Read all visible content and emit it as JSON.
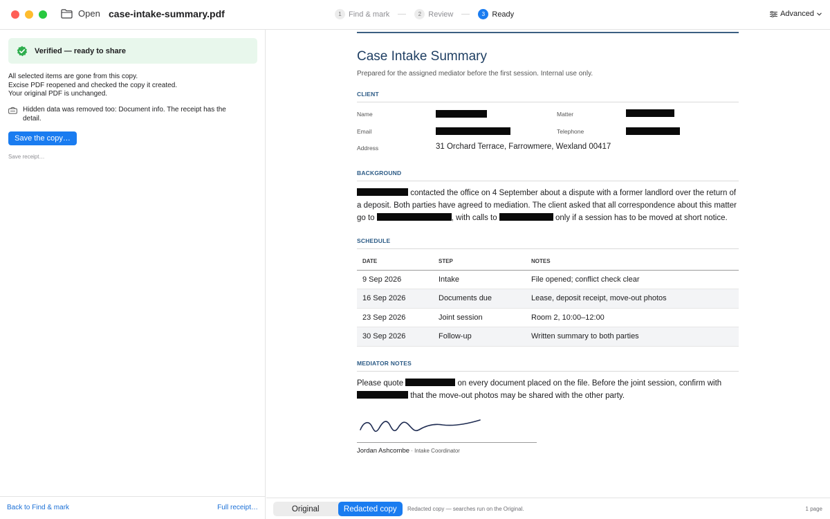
{
  "window": {
    "open_label": "Open",
    "filename": "case-intake-summary.pdf",
    "advanced_label": "Advanced",
    "steps": [
      {
        "num": "1",
        "label": "Find & mark"
      },
      {
        "num": "2",
        "label": "Review"
      },
      {
        "num": "3",
        "label": "Ready"
      }
    ],
    "active_step": 3
  },
  "sidebar": {
    "verified_title": "Verified — ready to share",
    "status_lines": [
      "All selected items are gone from this copy.",
      "Excise PDF reopened and checked the copy it created.",
      "Your original PDF is unchanged."
    ],
    "hidden_note": "Hidden data was removed too: Document info. The receipt has the detail.",
    "save_button": "Save the copy…",
    "save_receipt": "Save receipt…",
    "back_link": "Back to Find & mark",
    "full_receipt_link": "Full receipt…"
  },
  "document": {
    "title": "Case Intake Summary",
    "subtitle": "Prepared for the assigned mediator before the first session. Internal use only.",
    "client": {
      "heading": "CLIENT",
      "name_label": "Name",
      "matter_label": "Matter",
      "email_label": "Email",
      "telephone_label": "Telephone",
      "address_label": "Address",
      "address_value": "31 Orchard Terrace, Farrowmere, Wexland 00417"
    },
    "background": {
      "heading": "BACKGROUND",
      "part1": " contacted the office on 4 September about a dispute with a former landlord over the return of a deposit. Both parties have agreed to mediation. The client asked that all correspondence about this matter go to ",
      "part2": ", with calls to ",
      "part3": " only if a session has to be moved at short notice."
    },
    "schedule": {
      "heading": "SCHEDULE",
      "columns": [
        "DATE",
        "STEP",
        "NOTES"
      ],
      "rows": [
        [
          "9 Sep 2026",
          "Intake",
          "File opened; conflict check clear"
        ],
        [
          "16 Sep 2026",
          "Documents due",
          "Lease, deposit receipt, move-out photos"
        ],
        [
          "23 Sep 2026",
          "Joint session",
          "Room 2, 10:00–12:00"
        ],
        [
          "30 Sep 2026",
          "Follow-up",
          "Written summary to both parties"
        ]
      ]
    },
    "notes": {
      "heading": "MEDIATOR NOTES",
      "part1": "Please quote ",
      "part2": " on every document placed on the file. Before the joint session, confirm with ",
      "part3": " that the move-out photos may be shared with the other party."
    },
    "signature": {
      "name": "Jordan Ashcombe",
      "role": " · Intake Coordinator"
    }
  },
  "bottombar": {
    "original_label": "Original",
    "redacted_label": "Redacted copy",
    "note": "Redacted copy — searches run on the Original.",
    "page_count": "1 page"
  },
  "colors": {
    "accent": "#1a7cf0",
    "verified_bg": "#e8f7ec",
    "verified_check": "#2fae4e",
    "doc_heading": "#1f3f63",
    "section_heading": "#2b5a85",
    "redaction": "#0a0a0a"
  }
}
